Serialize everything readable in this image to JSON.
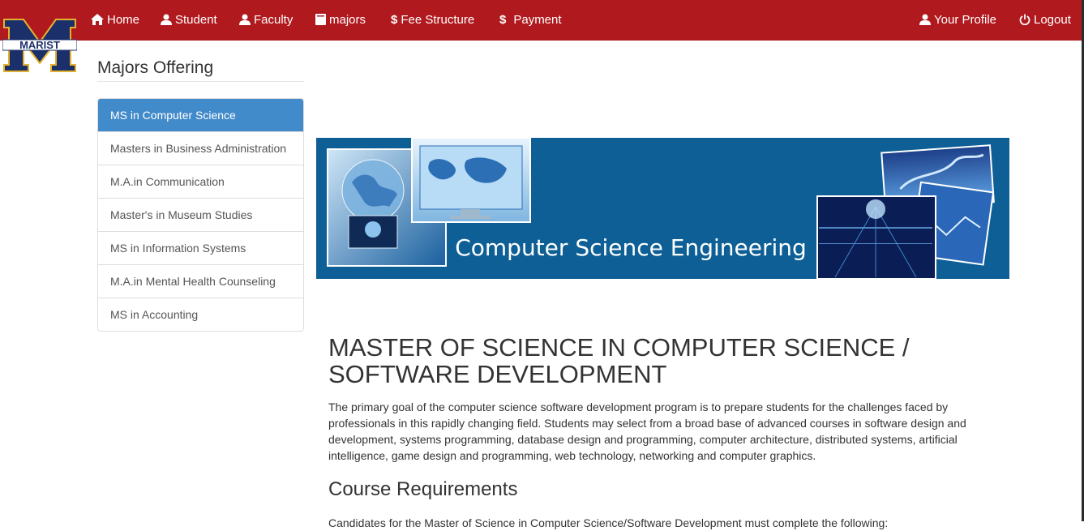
{
  "nav": {
    "home": "Home",
    "student": "Student",
    "faculty": "Faculty",
    "majors": "majors",
    "fee_structure": "Fee Structure",
    "payment": "Payment",
    "profile": "Your Profile",
    "logout": "Logout"
  },
  "logo": {
    "text": "MARIST"
  },
  "sidebar": {
    "title": "Majors Offering",
    "items": [
      {
        "label": "MS in Computer Science",
        "active": true
      },
      {
        "label": "Masters in Business Administration"
      },
      {
        "label": "M.A.in Communication"
      },
      {
        "label": "Master's in Museum Studies"
      },
      {
        "label": "MS in Information Systems"
      },
      {
        "label": "M.A.in Mental Health Counseling"
      },
      {
        "label": "MS in Accounting"
      }
    ]
  },
  "banner": {
    "text": "Computer Science Engineering"
  },
  "main": {
    "heading_line1": "MASTER OF SCIENCE IN COMPUTER SCIENCE /",
    "heading_line2": "SOFTWARE DEVELOPMENT",
    "intro": "The primary goal of the computer science software development program is to prepare students for the challenges faced by professionals in this rapidly changing field. Students may select from a broad base of advanced courses in software design and development, systems programming, database design and programming, computer architecture, distributed systems, artificial intelligence, game design and programming, web technology, networking and computer graphics.",
    "course_heading": "Course Requirements",
    "requirements_intro": "Candidates for the Master of Science in Computer Science/Software Development must complete the following:"
  },
  "colors": {
    "navbar": "#b0191e",
    "active_item": "#428bca",
    "banner_blue": "#0d5f95",
    "logo_navy": "#1b2f6b",
    "logo_gold": "#e3b230"
  }
}
